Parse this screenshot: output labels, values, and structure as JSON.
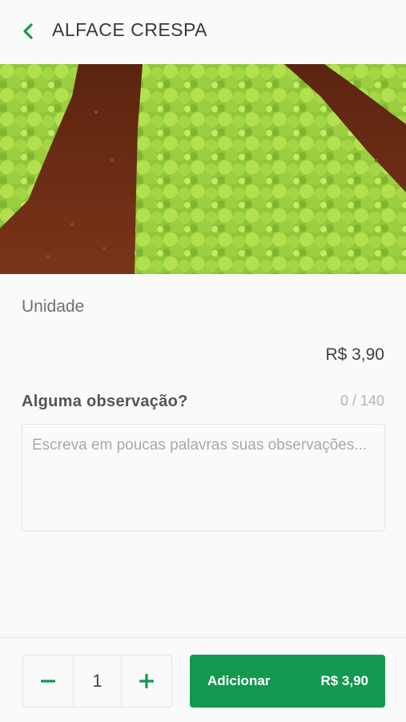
{
  "header": {
    "title": "ALFACE CRESPA",
    "back_icon": "chevron-left-icon"
  },
  "product": {
    "unit": "Unidade",
    "price": "R$ 3,90",
    "image_alt": "Plantação de alface crespa"
  },
  "observation": {
    "label": "Alguma observação?",
    "counter": "0 / 140",
    "value": "",
    "placeholder": "Escreva em poucas palavras suas observações..."
  },
  "footer": {
    "quantity": "1",
    "add_label": "Adicionar",
    "add_price": "R$ 3,90"
  },
  "colors": {
    "accent": "#12994f"
  }
}
